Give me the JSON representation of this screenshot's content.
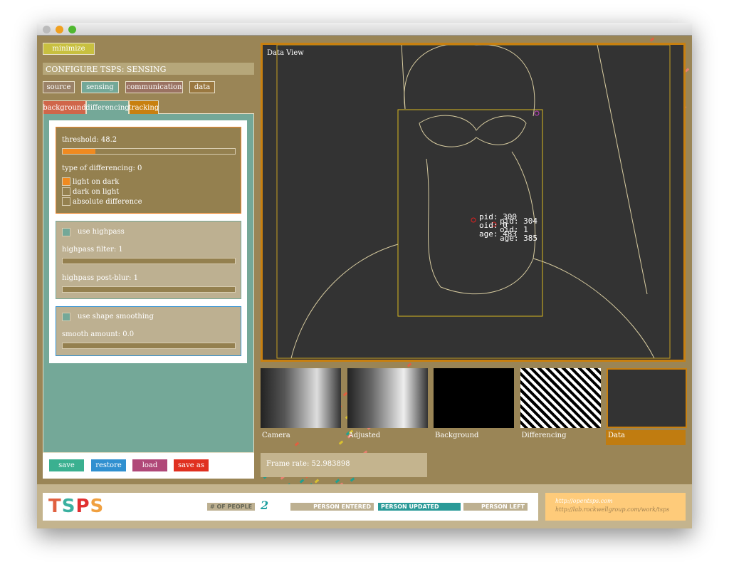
{
  "sidebar": {
    "minimize": "minimize",
    "header": "CONFIGURE TSPS: SENSING",
    "tabs": [
      {
        "label": "source",
        "color": "#9a8268"
      },
      {
        "label": "sensing",
        "color": "#74a898"
      },
      {
        "label": "communication",
        "color": "#9a7262"
      },
      {
        "label": "data",
        "color": "#9a7840"
      }
    ],
    "subtabs": [
      {
        "label": "background",
        "color": "#d0664a"
      },
      {
        "label": "differencing",
        "color": "#74a898"
      },
      {
        "label": "tracking",
        "color": "#c88010"
      }
    ],
    "threshold": {
      "label": "threshold: 48.2",
      "value": 48.2,
      "fill": 0.19
    },
    "differencing": {
      "label": "type of differencing: 0",
      "options": [
        {
          "label": "light on dark",
          "checked": true
        },
        {
          "label": "dark on light",
          "checked": false
        },
        {
          "label": "absolute difference",
          "checked": false
        }
      ]
    },
    "highpass": {
      "toggle": "use highpass",
      "filter": "highpass filter: 1",
      "blur": "highpass post-blur: 1"
    },
    "smoothing": {
      "toggle": "use shape smoothing",
      "amount": "smooth amount: 0.0"
    },
    "buttons": [
      {
        "label": "save",
        "color": "#3ab090"
      },
      {
        "label": "restore",
        "color": "#3090d0"
      },
      {
        "label": "load",
        "color": "#b04878"
      },
      {
        "label": "save as",
        "color": "#e03020"
      }
    ]
  },
  "dataview": {
    "title": "Data View",
    "blobs": [
      {
        "pid": "pid: 300",
        "oid": "oid: 0",
        "age": "age: 483"
      },
      {
        "pid": "pid: 304",
        "oid": "oid: 1",
        "age": "age: 385"
      }
    ]
  },
  "thumbs": [
    "Camera",
    "Adjusted",
    "Background",
    "Differencing",
    "Data"
  ],
  "framerate": "Frame rate: 52.983898",
  "footer": {
    "logo": "TSPS",
    "people_label": "# OF PEOPLE",
    "people_count": "2",
    "events": [
      "PERSON ENTERED",
      "PERSON UPDATED",
      "PERSON LEFT"
    ],
    "links": [
      "http://opentsps.com",
      "http://lab.rockwellgroup.com/work/tsps"
    ]
  }
}
